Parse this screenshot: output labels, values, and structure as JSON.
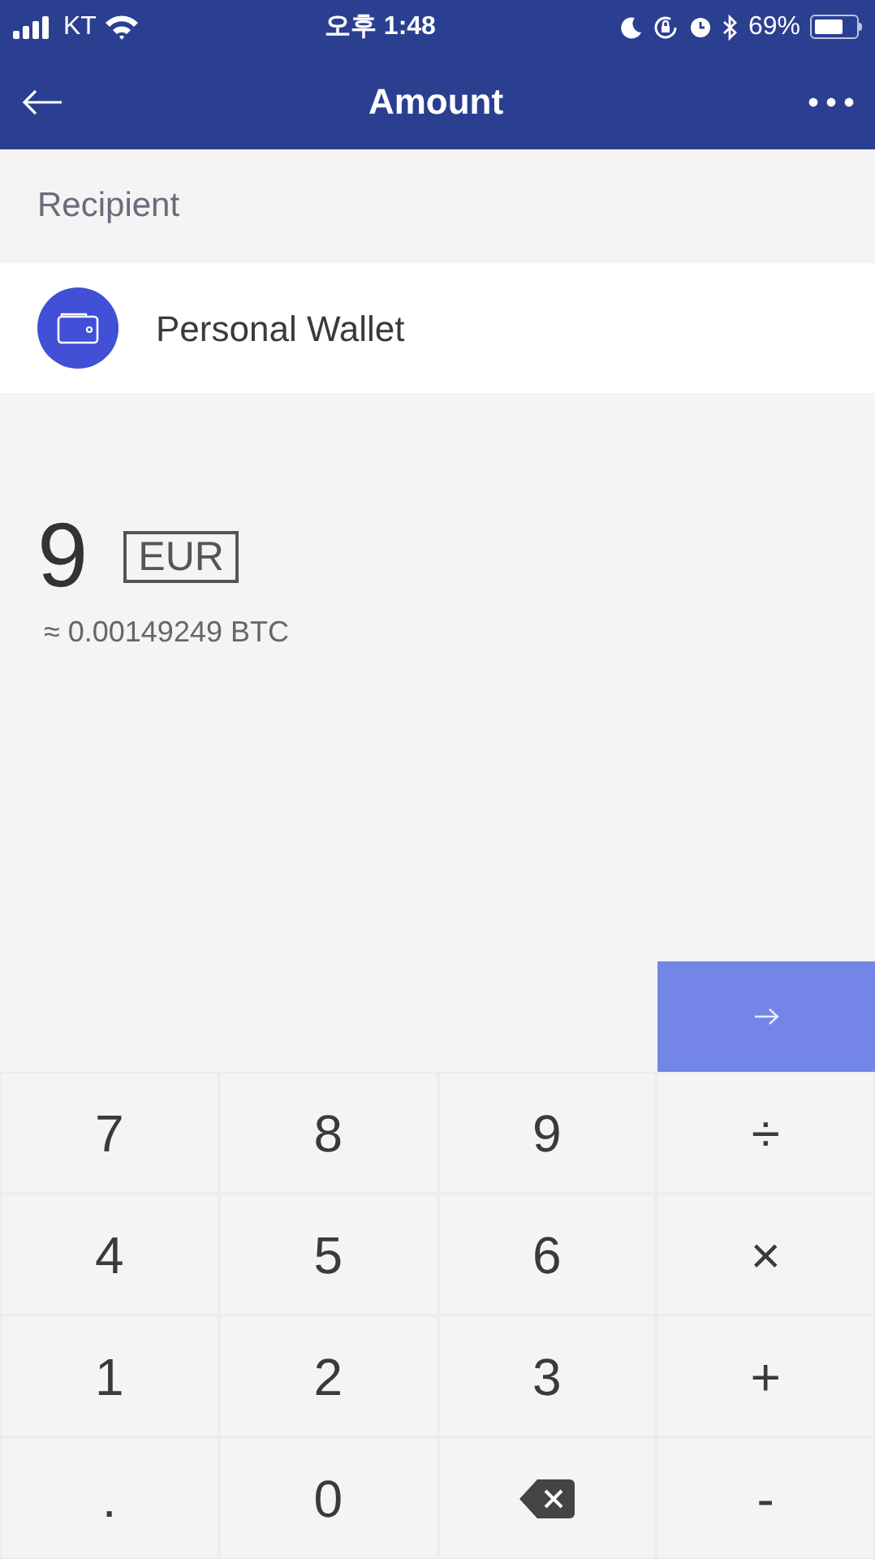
{
  "status_bar": {
    "carrier": "KT",
    "time": "오후 1:48",
    "battery": "69%"
  },
  "nav": {
    "title": "Amount"
  },
  "recipient": {
    "heading": "Recipient",
    "name": "Personal Wallet"
  },
  "amount": {
    "value": "9",
    "currency": "EUR",
    "conversion": "≈ 0.00149249 BTC"
  },
  "keypad": [
    {
      "kind": "char",
      "label": "7"
    },
    {
      "kind": "char",
      "label": "8"
    },
    {
      "kind": "char",
      "label": "9"
    },
    {
      "kind": "char",
      "label": "÷"
    },
    {
      "kind": "char",
      "label": "4"
    },
    {
      "kind": "char",
      "label": "5"
    },
    {
      "kind": "char",
      "label": "6"
    },
    {
      "kind": "char",
      "label": "×"
    },
    {
      "kind": "char",
      "label": "1"
    },
    {
      "kind": "char",
      "label": "2"
    },
    {
      "kind": "char",
      "label": "3"
    },
    {
      "kind": "char",
      "label": "+"
    },
    {
      "kind": "char",
      "label": "."
    },
    {
      "kind": "char",
      "label": "0"
    },
    {
      "kind": "backspace"
    },
    {
      "kind": "char",
      "label": "-"
    }
  ]
}
